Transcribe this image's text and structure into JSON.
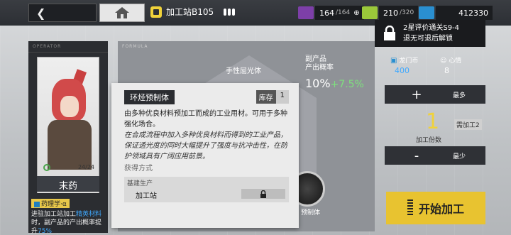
{
  "header": {
    "station_name": "加工站B105",
    "resources": {
      "drones": "164",
      "drones_max": "/164",
      "lmd_storage": "210",
      "lmd_storage_max": "/320",
      "orundum": "412330"
    }
  },
  "operator": {
    "section_label": "OPERATOR",
    "name": "末药",
    "level": "24/24",
    "skill_tag": "药理学·α",
    "skill_desc_before": "进驻加工站加工",
    "skill_desc_highlight": "精英材料",
    "skill_desc_after": "时，副产品的产出概率提升",
    "skill_desc_value": "75%"
  },
  "formula": {
    "section_label": "FORMULA",
    "top_product": "手性屈光体",
    "byproduct_label_1": "副产品",
    "byproduct_label_2": "产出概率",
    "byproduct_base": "10%",
    "byproduct_bonus": "+7.5%",
    "slot_label": "预制体"
  },
  "tooltip": {
    "title": "环烃预制体",
    "stock_label": "库存",
    "stock_value": "1",
    "description": "由多种优良材料预加工而成的工业用材。可用于多种强化场合。",
    "story": "在合成流程中加入多种优良材料而得到的工业产品，保证透光度的同时大幅提升了强度与抗冲击性，在防护领域具有广阔应用前景。",
    "source_label": "获得方式",
    "source_head": "基建生产",
    "source_item": "加工站"
  },
  "unlock": {
    "line1": "2星评价通关S9-4",
    "line2": "退无可退后解锁"
  },
  "stats": {
    "lmd_label": "龙门币",
    "lmd_value": "400",
    "mood_label": "心情",
    "mood_value": "8"
  },
  "quantity": {
    "plus_symbol": "+",
    "minus_symbol": "-",
    "max_label": "最多",
    "min_label": "最少",
    "value": "1",
    "need_label": "需加工2",
    "count_label": "加工份数"
  },
  "actions": {
    "start_label": "开始加工"
  },
  "colors": {
    "accent_yellow": "#e8c330",
    "highlight_blue": "#3fa9ff",
    "bonus_green": "#7ee07e"
  }
}
